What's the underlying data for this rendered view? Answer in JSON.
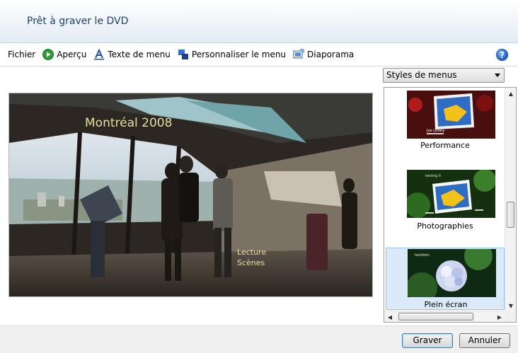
{
  "window": {
    "title": "Prêt à graver le DVD"
  },
  "toolbar": {
    "file": "Fichier",
    "preview": "Aperçu",
    "menu_text": "Texte de menu",
    "customize_menu": "Personnaliser le menu",
    "slideshow": "Diaporama",
    "help": "?"
  },
  "preview": {
    "menu_title": "Montréal 2008",
    "play_label": "Lecture",
    "scenes_label": "Scènes"
  },
  "styles": {
    "dropdown_value": "Styles de menus",
    "items": [
      {
        "label": "Performance",
        "thumb_text": "Joe Lovely"
      },
      {
        "label": "Photographies",
        "thumb_text": "testing II"
      },
      {
        "label": "Plein écran",
        "thumb_text": "testdotn"
      }
    ],
    "selected_index": 2
  },
  "footer": {
    "burn": "Graver",
    "cancel": "Annuler"
  },
  "colors": {
    "title_text": "#1e3f73",
    "menu_title_text": "#e6dfa2",
    "selection": "#dbeaf9"
  }
}
